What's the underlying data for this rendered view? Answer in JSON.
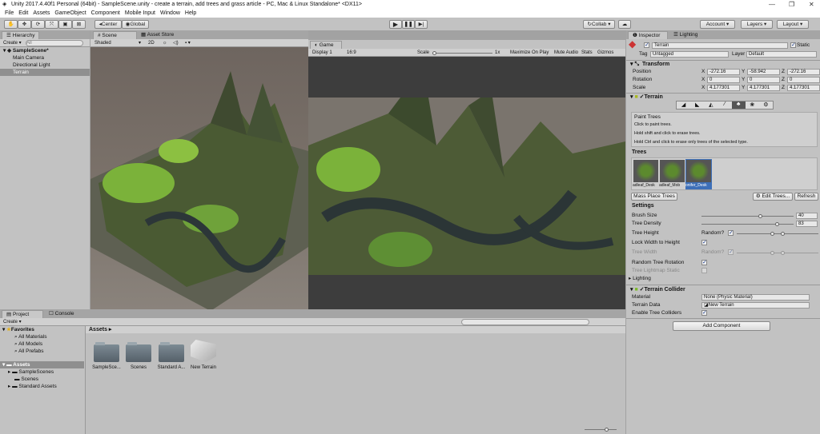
{
  "window": {
    "title": "Unity 2017.4.40f1 Personal (64bit) - SampleScene.unity - create a terrain, add trees and grass article - PC, Mac & Linux Standalone* <DX11>"
  },
  "menu": [
    "File",
    "Edit",
    "Assets",
    "GameObject",
    "Component",
    "Mobile Input",
    "Window",
    "Help"
  ],
  "toolbar": {
    "center": "Center",
    "global": "Global",
    "collab": "Collab",
    "account": "Account",
    "layers": "Layers",
    "layout": "Layout"
  },
  "hierarchy": {
    "tab": "Hierarchy",
    "create": "Create",
    "search_placeholder": "All",
    "scene": "SampleScene*",
    "items": [
      "Main Camera",
      "Directional Light",
      "Terrain"
    ]
  },
  "scene": {
    "tab": "Scene",
    "asset_store": "Asset Store",
    "shading": "Shaded",
    "mode2d": "2D"
  },
  "game": {
    "tab": "Game",
    "display": "Display 1",
    "aspect": "16:9",
    "scale_label": "Scale",
    "scale_value": "1x",
    "maximize": "Maximize On Play",
    "mute": "Mute Audio",
    "stats": "Stats",
    "gizmos": "Gizmos"
  },
  "inspector": {
    "tab": "Inspector",
    "lighting_tab": "Lighting",
    "object_name": "Terrain",
    "static": "Static",
    "tag_label": "Tag",
    "tag": "Untagged",
    "layer_label": "Layer",
    "layer": "Default",
    "transform": {
      "title": "Transform",
      "position_label": "Position",
      "rotation_label": "Rotation",
      "scale_label": "Scale",
      "position": [
        "-272.16",
        "-58.942",
        "-272.16"
      ],
      "rotation": [
        "0",
        "0",
        "0"
      ],
      "scale": [
        "4.177301",
        "4.177301",
        "4.177301"
      ],
      "axes": [
        "X",
        "Y",
        "Z"
      ]
    },
    "terrain": {
      "title": "Terrain",
      "help_title": "Paint Trees",
      "help_lines": [
        "Click to paint trees.",
        "Hold shift and click to erase trees.",
        "Hold Ctrl and click to erase only trees of the selected type."
      ],
      "trees_label": "Trees",
      "tree_items": [
        "adleaf_Desk",
        "adleaf_Mob",
        "onifer_Desk"
      ],
      "mass_place": "Mass Place Trees",
      "edit_trees": "Edit Trees...",
      "refresh": "Refresh",
      "settings_label": "Settings",
      "brush_size_label": "Brush Size",
      "brush_size": "40",
      "brush_size_fraction": 0.64,
      "tree_density_label": "Tree Density",
      "tree_density": "83",
      "tree_density_fraction": 0.83,
      "tree_height_label": "Tree Height",
      "random_label": "Random?",
      "lock_width_label": "Lock Width to Height",
      "tree_width_label": "Tree Width",
      "random_rotation_label": "Random Tree Rotation",
      "lightmap_static_label": "Tree Lightmap Static",
      "lighting_label": "Lighting"
    },
    "collider": {
      "title": "Terrain Collider",
      "material_label": "Material",
      "material": "None (Physic Material)",
      "data_label": "Terrain Data",
      "data": "New Terrain",
      "enable_label": "Enable Tree Colliders"
    },
    "add_component": "Add Component"
  },
  "project": {
    "tab": "Project",
    "console_tab": "Console",
    "create": "Create",
    "favorites": "Favorites",
    "fav_items": [
      "All Materials",
      "All Models",
      "All Prefabs"
    ],
    "assets_root": "Assets",
    "asset_folders": [
      "SampleScenes",
      "Scenes",
      "Standard Assets"
    ],
    "breadcrumb": "Assets",
    "grid_items": [
      "SampleSce...",
      "Scenes",
      "Standard A...",
      "New Terrain"
    ]
  }
}
